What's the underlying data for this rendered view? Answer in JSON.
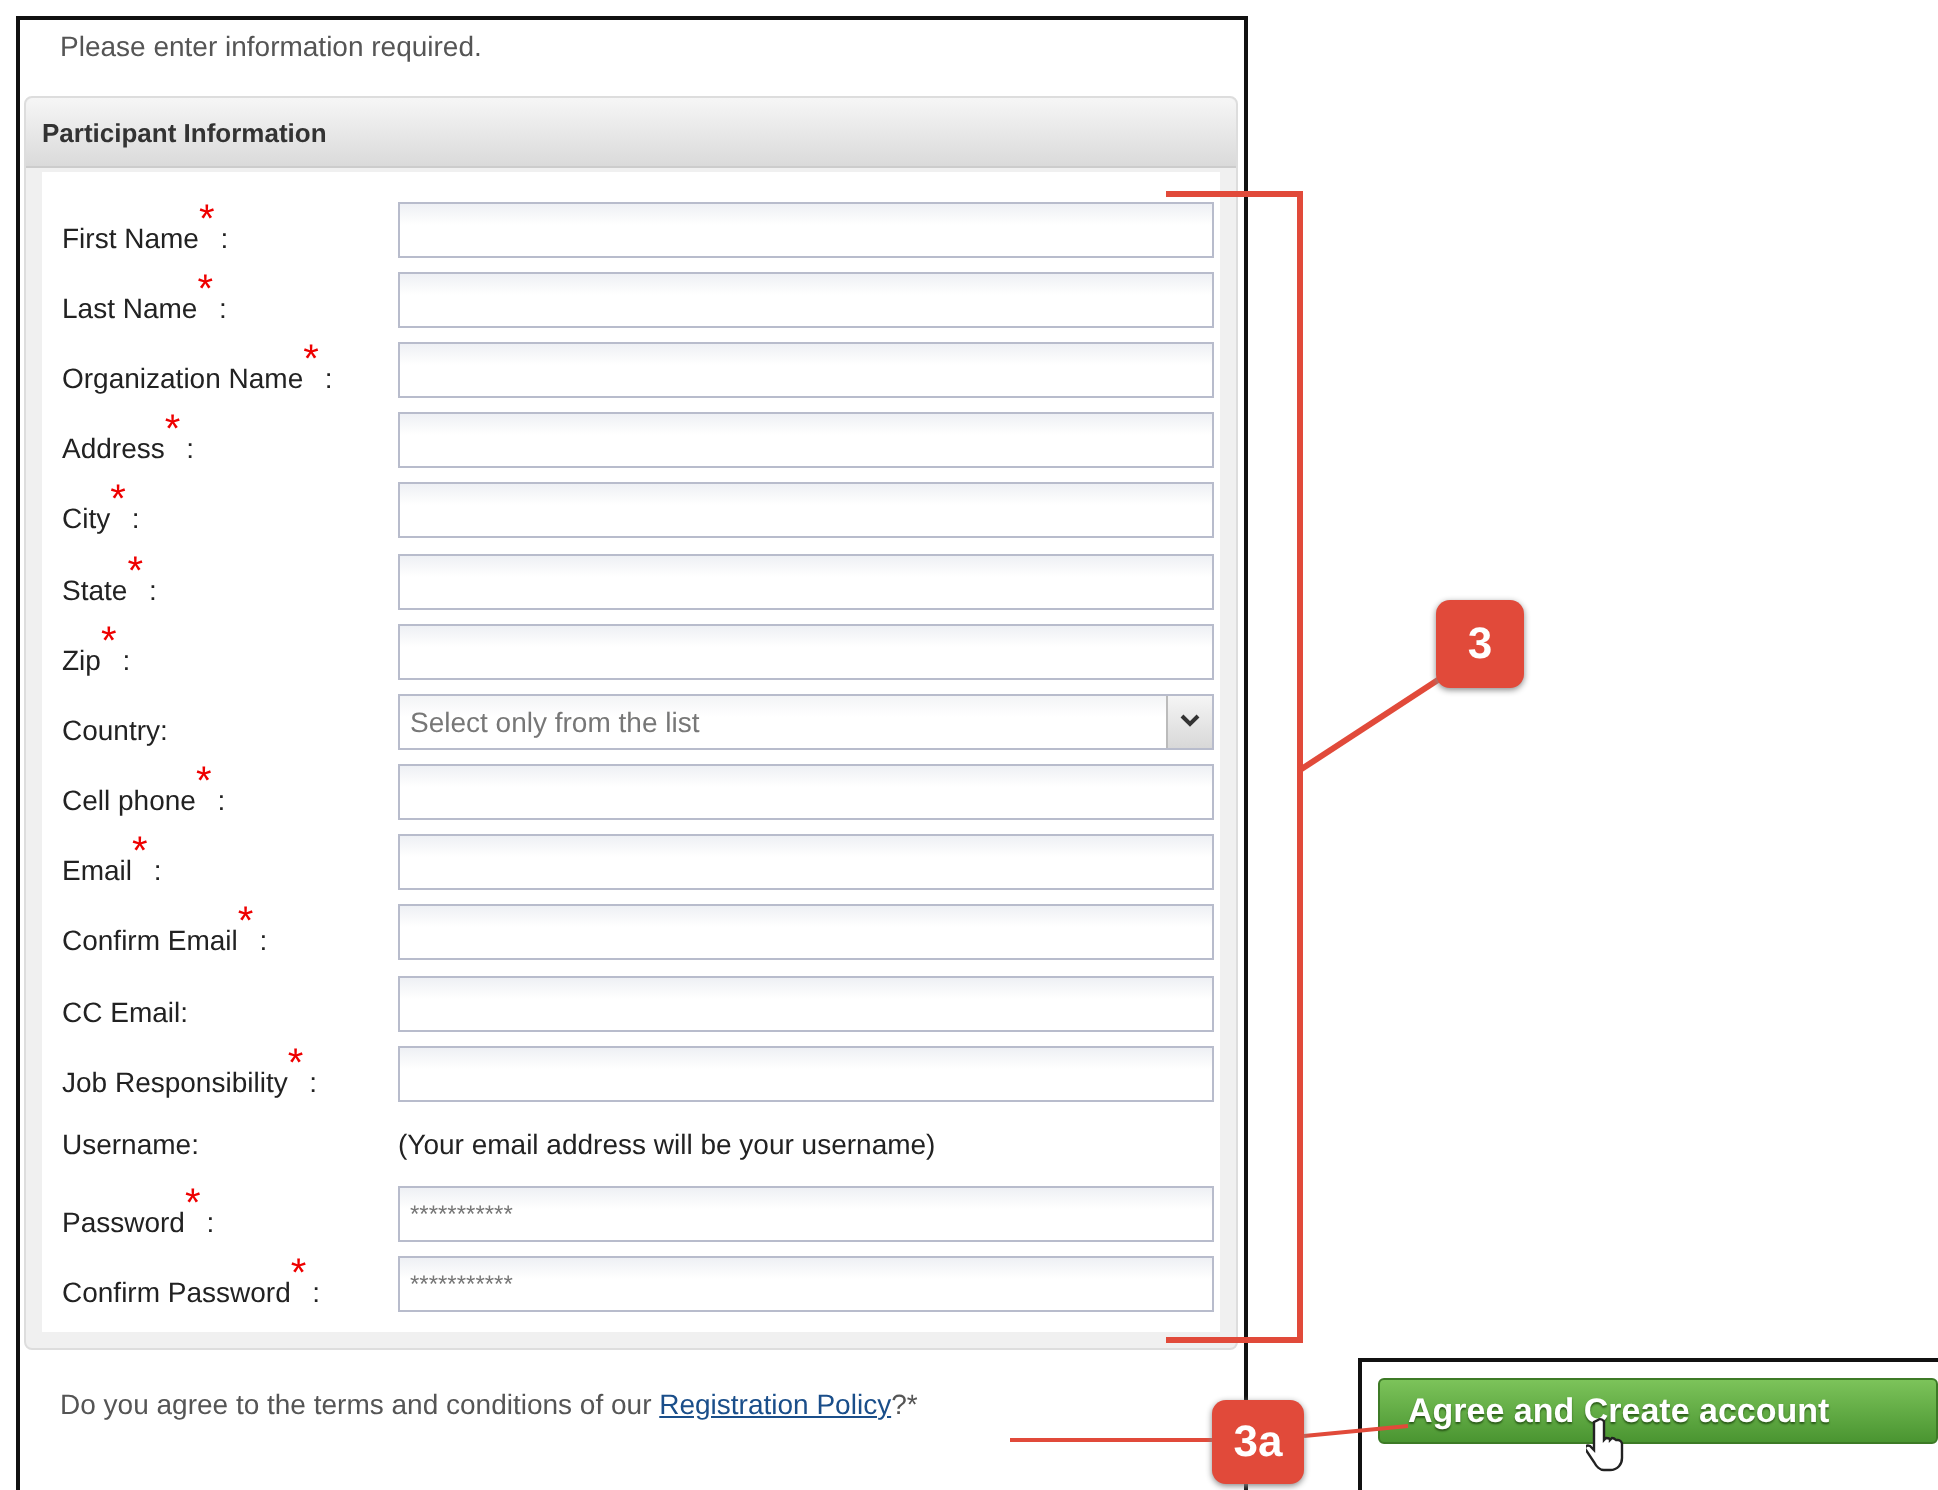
{
  "intro": "Please enter information required.",
  "section": {
    "title": "Participant Information",
    "fields": [
      {
        "kind": "text",
        "label": "First Name",
        "mark": "*",
        "suffix": ":"
      },
      {
        "kind": "text",
        "label": "Last Name",
        "mark": "*",
        "suffix": ":"
      },
      {
        "kind": "text",
        "label": "Organization Name",
        "mark": "*",
        "suffix": ":"
      },
      {
        "kind": "text",
        "label": "Address",
        "mark": "*",
        "suffix": ":"
      },
      {
        "kind": "text",
        "label": "City",
        "mark": "*",
        "suffix": ":"
      },
      {
        "kind": "text",
        "label": "State",
        "mark": "*",
        "suffix": ":"
      },
      {
        "kind": "text",
        "label": "Zip",
        "mark": "*",
        "suffix": ":"
      },
      {
        "kind": "select",
        "label": "Country:",
        "placeholder": "Select only from the list"
      },
      {
        "kind": "text",
        "label": "Cell phone",
        "mark": "*",
        "suffix": ":"
      },
      {
        "kind": "text",
        "label": "Email",
        "mark": "*",
        "suffix": ":"
      },
      {
        "kind": "text",
        "label": "Confirm Email",
        "mark": "*",
        "suffix": ":"
      },
      {
        "kind": "text",
        "label": "CC Email:"
      },
      {
        "kind": "text",
        "label": "Job Responsibility",
        "mark": "*",
        "suffix": ":"
      },
      {
        "kind": "note",
        "label": "Username:",
        "note": "(Your email address will be your username)"
      },
      {
        "kind": "password",
        "label": "Password",
        "mark": "*",
        "suffix": ":",
        "value": "***********"
      },
      {
        "kind": "password",
        "label": "Confirm Password",
        "mark": "*",
        "suffix": ":",
        "value": "***********"
      }
    ]
  },
  "agreement": {
    "text": "Do you agree to the terms and conditions of our ",
    "link": "Registration Policy",
    "after": "?*"
  },
  "button": "Agree and Create account",
  "callouts": [
    "3",
    "3a"
  ]
}
